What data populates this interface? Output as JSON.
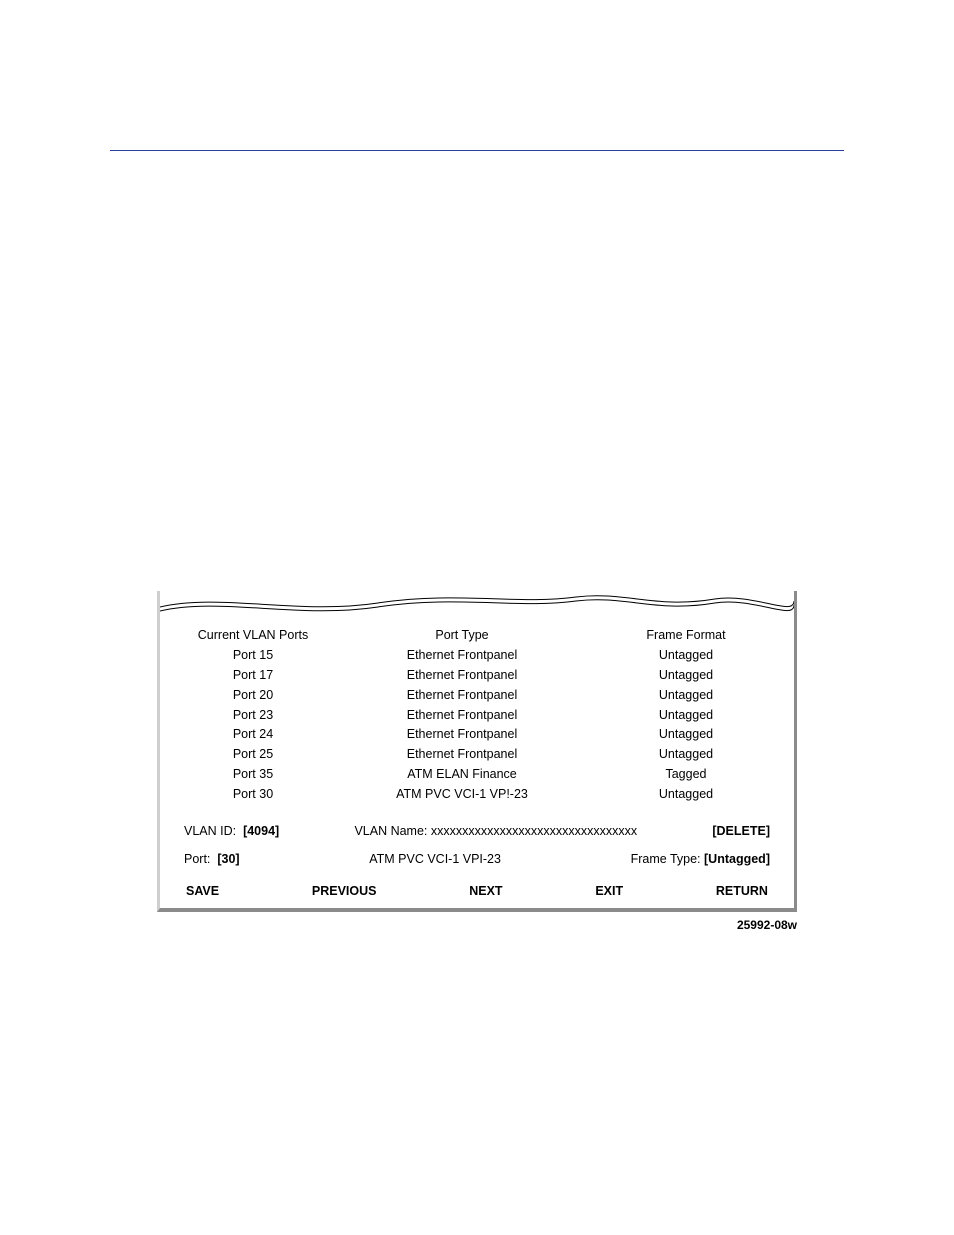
{
  "table": {
    "headers": {
      "ports": "Current VLAN Ports",
      "type": "Port Type",
      "frame": "Frame Format"
    },
    "rows": [
      {
        "port": "Port 15",
        "type": "Ethernet Frontpanel",
        "frame": "Untagged"
      },
      {
        "port": "Port 17",
        "type": "Ethernet Frontpanel",
        "frame": "Untagged"
      },
      {
        "port": "Port 20",
        "type": "Ethernet Frontpanel",
        "frame": "Untagged"
      },
      {
        "port": "Port 23",
        "type": "Ethernet Frontpanel",
        "frame": "Untagged"
      },
      {
        "port": "Port 24",
        "type": "Ethernet Frontpanel",
        "frame": "Untagged"
      },
      {
        "port": "Port 25",
        "type": "Ethernet Frontpanel",
        "frame": "Untagged"
      },
      {
        "port": "Port 35",
        "type": "ATM  ELAN Finance",
        "frame": "Tagged"
      },
      {
        "port": "Port 30",
        "type": "ATM PVC VCI-1  VP!-23",
        "frame": "Untagged"
      }
    ]
  },
  "form": {
    "vlan_id_label": "VLAN ID:",
    "vlan_id_value": "[4094]",
    "vlan_name_label": "VLAN Name:",
    "vlan_name_value": "xxxxxxxxxxxxxxxxxxxxxxxxxxxxxxxxx",
    "delete_label": "[DELETE]",
    "port_label": "Port:",
    "port_value": "[30]",
    "port_type_text": "ATM PVC VCI-1 VPI-23",
    "frame_type_label": "Frame Type:",
    "frame_type_value": "[Untagged]"
  },
  "actions": {
    "save": "SAVE",
    "previous": "PREVIOUS",
    "next": "NEXT",
    "exit": "EXIT",
    "return": "RETURN"
  },
  "figure_id": "25992-08w"
}
